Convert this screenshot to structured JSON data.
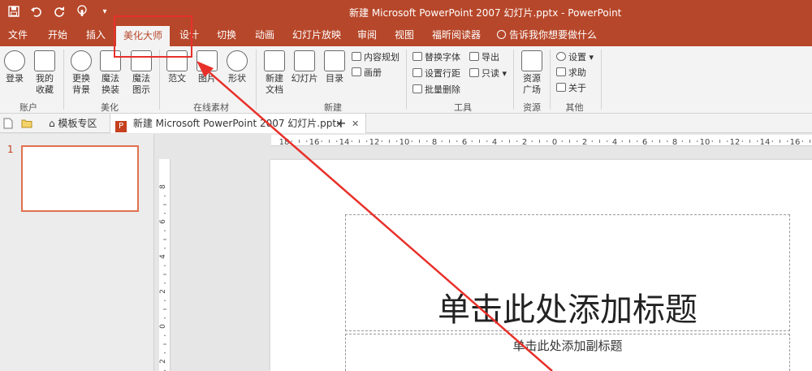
{
  "window": {
    "title": "新建 Microsoft PowerPoint 2007 幻灯片.pptx  -  PowerPoint"
  },
  "qat": {
    "save": "save-icon",
    "undo": "undo-icon",
    "redo": "redo-icon",
    "touch": "touch-mode-icon",
    "more": "▾"
  },
  "tabs": [
    {
      "id": "file",
      "label": "文件"
    },
    {
      "id": "home",
      "label": "开始"
    },
    {
      "id": "insert",
      "label": "插入"
    },
    {
      "id": "beautify",
      "label": "美化大师"
    },
    {
      "id": "design",
      "label": "设计"
    },
    {
      "id": "transitions",
      "label": "切换"
    },
    {
      "id": "animations",
      "label": "动画"
    },
    {
      "id": "slideshow",
      "label": "幻灯片放映"
    },
    {
      "id": "review",
      "label": "审阅"
    },
    {
      "id": "view",
      "label": "视图"
    },
    {
      "id": "foxit",
      "label": "福昕阅读器"
    }
  ],
  "tell_me": "告诉我你想要做什么",
  "ribbon": {
    "login": "登录",
    "fav1": "我的",
    "fav2": "收藏",
    "bg1": "更换",
    "bg2": "背景",
    "magic_swap1": "魔法",
    "magic_swap2": "换装",
    "magic_illus1": "魔法",
    "magic_illus2": "图示",
    "template": "范文",
    "picture": "图片",
    "shape": "形状",
    "newdoc1": "新建",
    "newdoc2": "文档",
    "slides": "幻灯片",
    "toc": "目录",
    "content_plan": "内容规划",
    "album": "画册",
    "replace_font": "替换字体",
    "export": "导出",
    "line_spacing": "设置行距",
    "read_only": "只读",
    "batch_delete": "批量删除",
    "resource1": "资源",
    "resource2": "广场",
    "settings": "设置",
    "help": "求助",
    "about": "关于",
    "groups": {
      "account": "账户",
      "beautify": "美化",
      "online": "在线素材",
      "new": "新建",
      "tools": "工具",
      "resources": "资源",
      "other": "其他"
    }
  },
  "doctabs": {
    "template_zone": "模板专区",
    "current_doc": "新建 Microsoft PowerPoint 2007 幻灯片.pptx",
    "close": "✕",
    "add": "+"
  },
  "thumbnails": {
    "slide_number": "1"
  },
  "hruler_labels": [
    "18",
    "16",
    "14",
    "12",
    "10",
    "8",
    "6",
    "4",
    "2",
    "0",
    "2",
    "4",
    "6",
    "8",
    "10",
    "12",
    "14",
    "16"
  ],
  "vruler_labels": [
    "8",
    "6",
    "4",
    "2",
    "0",
    "2"
  ],
  "slide": {
    "title_placeholder": "单击此处添加标题",
    "subtitle_placeholder": "单击此处添加副标题"
  },
  "colors": {
    "accent": "#b7472a",
    "highlight": "#e8302a"
  }
}
